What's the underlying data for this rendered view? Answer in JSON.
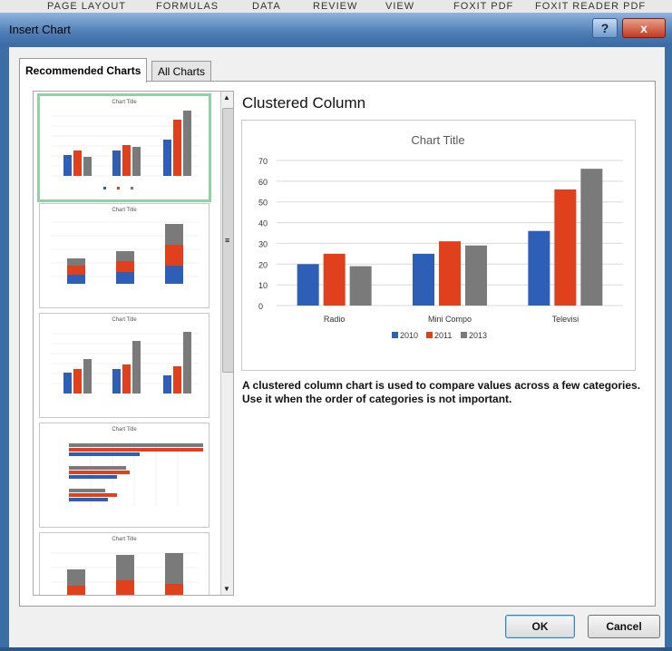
{
  "window": {
    "title": "Insert Chart",
    "help_label": "?",
    "close_label": "x"
  },
  "ribbon": {
    "items": [
      "PAGE LAYOUT",
      "FORMULAS",
      "DATA",
      "REVIEW",
      "VIEW",
      "FOXIT PDF",
      "FOXIT READER PDF"
    ]
  },
  "tabs": {
    "recommended": "Recommended Charts",
    "all": "All Charts"
  },
  "thumbnails": {
    "titles": [
      "Chart Title",
      "Chart Title",
      "Chart Title",
      "Chart Title",
      "Chart Title"
    ]
  },
  "preview": {
    "chart_type": "Clustered Column",
    "description": "A clustered column chart is used to compare values across a few categories. Use it when the order of categories is not important."
  },
  "buttons": {
    "ok": "OK",
    "cancel": "Cancel"
  },
  "colors": {
    "series_2010": "#2e5fb7",
    "series_2011": "#e0401b",
    "series_2013": "#7a7a7a",
    "selected_border": "#8fd3a5"
  },
  "chart_data": {
    "type": "bar",
    "title": "Chart Title",
    "categories": [
      "Radio",
      "Mini Compo",
      "Televisi"
    ],
    "series": [
      {
        "name": "2010",
        "values": [
          20,
          25,
          36
        ]
      },
      {
        "name": "2011",
        "values": [
          25,
          31,
          56
        ]
      },
      {
        "name": "2013",
        "values": [
          19,
          29,
          66
        ]
      }
    ],
    "ylim": [
      0,
      70
    ],
    "yticks": [
      "0",
      "10",
      "20",
      "30",
      "40",
      "50",
      "60",
      "70"
    ],
    "legend": "bottom",
    "grid": true
  }
}
